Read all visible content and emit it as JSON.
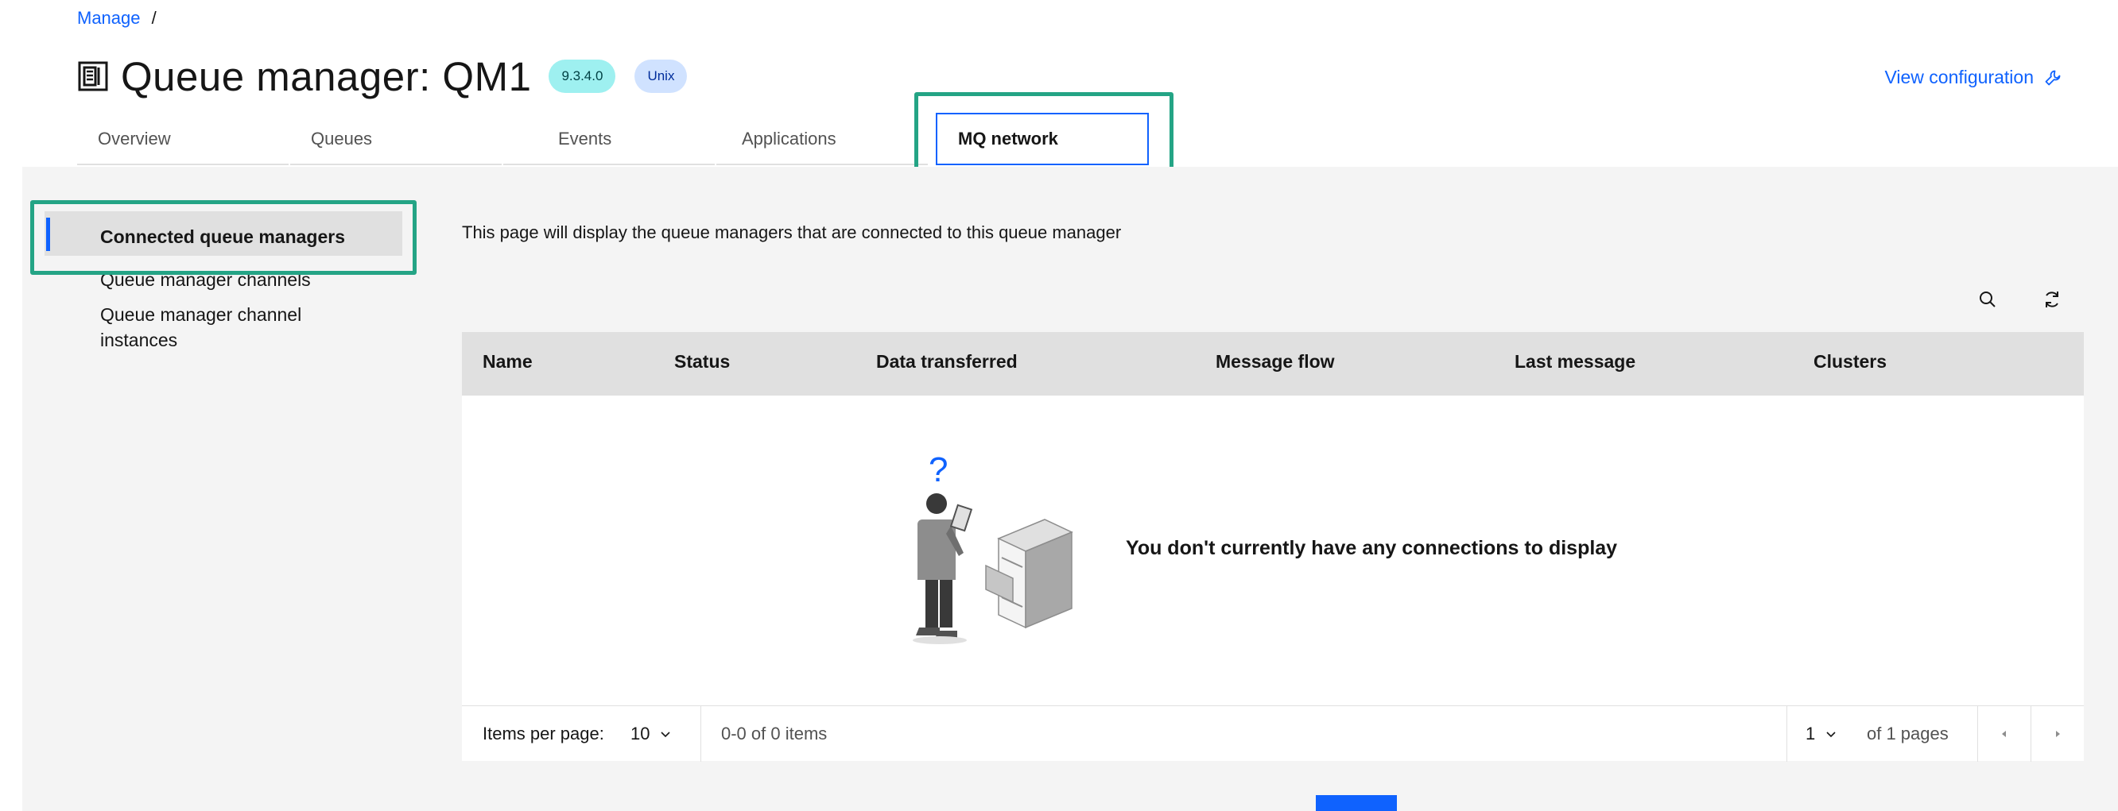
{
  "breadcrumb": {
    "manage": "Manage",
    "separator": "/"
  },
  "header": {
    "title": "Queue manager: QM1",
    "version_tag": "9.3.4.0",
    "os_tag": "Unix",
    "view_configuration": "View configuration",
    "icons": {
      "queue_manager": "queue-manager-icon",
      "settings": "wrench-icon"
    }
  },
  "tabs": [
    {
      "label": "Overview"
    },
    {
      "label": "Queues"
    },
    {
      "label": "Events"
    },
    {
      "label": "Applications"
    },
    {
      "label": "MQ network",
      "selected": true
    }
  ],
  "sidebar": {
    "items": [
      {
        "label": "Connected queue managers",
        "selected": true
      },
      {
        "label": "Queue manager channels"
      },
      {
        "label": "Queue manager channel instances"
      }
    ]
  },
  "main": {
    "description": "This page will display the queue managers that are connected to this queue manager",
    "toolbar_icons": [
      "search-icon",
      "refresh-icon"
    ],
    "table": {
      "columns": [
        "Name",
        "Status",
        "Data transferred",
        "Message flow",
        "Last message",
        "Clusters"
      ],
      "rows": [],
      "empty_message": "You don't currently have any connections to display",
      "empty_icon": "question-mark-icon"
    },
    "pagination": {
      "items_per_page_label": "Items per page:",
      "items_per_page": "10",
      "range_text": "0-0 of 0 items",
      "current_page": "1",
      "page_count_text": "of 1 pages"
    }
  },
  "colors": {
    "accent": "#0f62fe",
    "highlight": "#24a485",
    "version_tag_bg": "#9ef0f0",
    "os_tag_bg": "#d0e2ff"
  }
}
